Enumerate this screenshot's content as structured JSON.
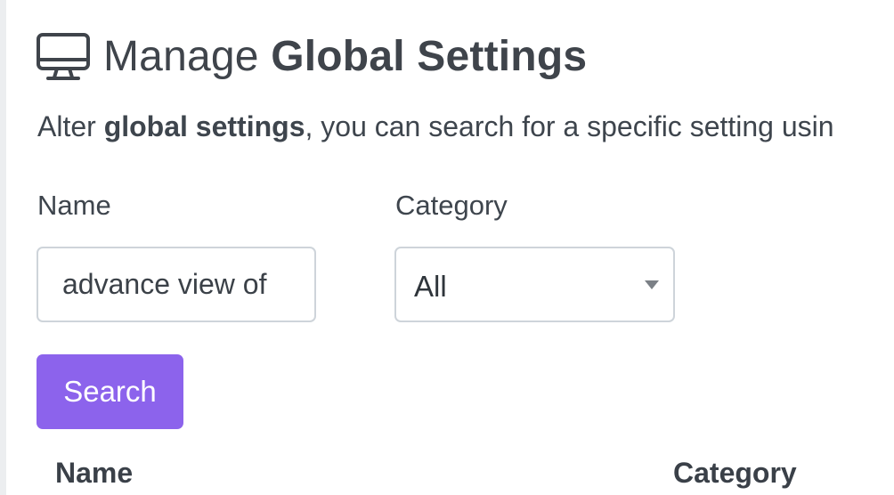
{
  "page": {
    "title_prefix": "Manage ",
    "title_strong": "Global Settings",
    "heading_icon": "monitor-icon",
    "description": {
      "prefix": "Alter ",
      "strong": "global settings",
      "suffix": ", you can search for a specific setting usin"
    }
  },
  "filters": {
    "name_label": "Name",
    "name_value": "advance view of",
    "category_label": "Category",
    "category_selected": "All"
  },
  "actions": {
    "search_label": "Search"
  },
  "table": {
    "columns": [
      "Name",
      "Category"
    ]
  },
  "colors": {
    "accent": "#8c63ec",
    "text": "#3e454d",
    "border": "#ced4da"
  }
}
